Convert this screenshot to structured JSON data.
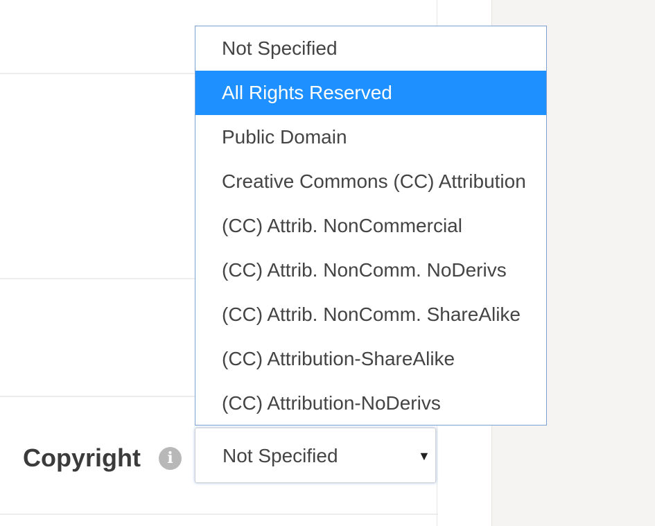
{
  "copyright_field": {
    "label": "Copyright",
    "info_icon_glyph": "i",
    "selected_value": "Not Specified",
    "dropdown_arrow": "▼"
  },
  "dropdown": {
    "highlighted_color": "#1e90ff",
    "options": [
      "Not Specified",
      "All Rights Reserved",
      "Public Domain",
      "Creative Commons (CC) Attribution",
      "(CC) Attrib. NonCommercial",
      "(CC) Attrib. NonComm. NoDerivs",
      "(CC) Attrib. NonComm. ShareAlike",
      "(CC) Attribution-ShareAlike",
      "(CC) Attribution-NoDerivs"
    ]
  }
}
